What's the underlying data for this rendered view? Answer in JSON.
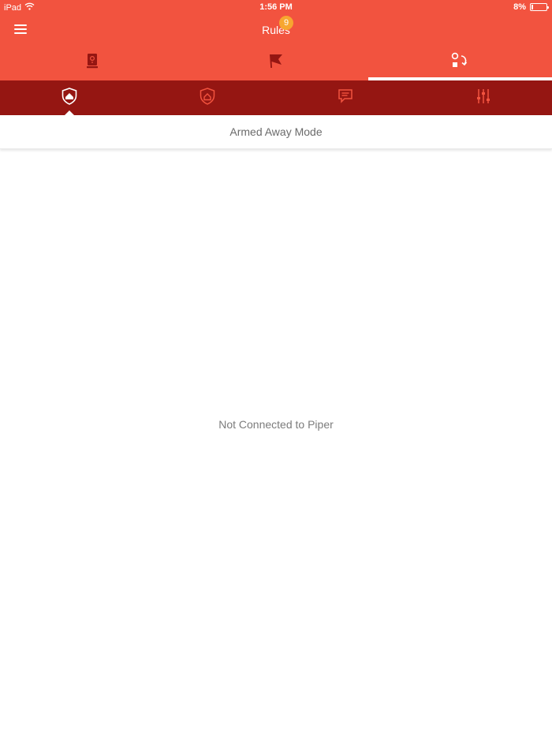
{
  "status_bar": {
    "device": "iPad",
    "time": "1:56 PM",
    "battery": "8%",
    "battery_level": 0.08,
    "icons": [
      "wifi-icon",
      "battery-icon"
    ]
  },
  "header": {
    "title": "Rules",
    "menu_icon": "hamburger-menu-icon"
  },
  "main_tabs": [
    {
      "icon": "piper-device-icon",
      "active": false
    },
    {
      "icon": "flag-icon",
      "badge": "9",
      "active": false
    },
    {
      "icon": "rules-icon",
      "active": true
    }
  ],
  "sub_tabs": [
    {
      "icon": "armed-away-shield-icon",
      "active": true
    },
    {
      "icon": "armed-stay-shield-icon",
      "active": false
    },
    {
      "icon": "message-icon",
      "active": false
    },
    {
      "icon": "sliders-icon",
      "active": false
    }
  ],
  "mode": {
    "label": "Armed Away Mode"
  },
  "content": {
    "empty_message": "Not Connected to Piper"
  },
  "colors": {
    "header_bg": "#f2533f",
    "subtabs_bg": "#951612",
    "badge": "#f7a630",
    "icon_inactive": "#f2533f",
    "icon_dark": "#951612"
  }
}
